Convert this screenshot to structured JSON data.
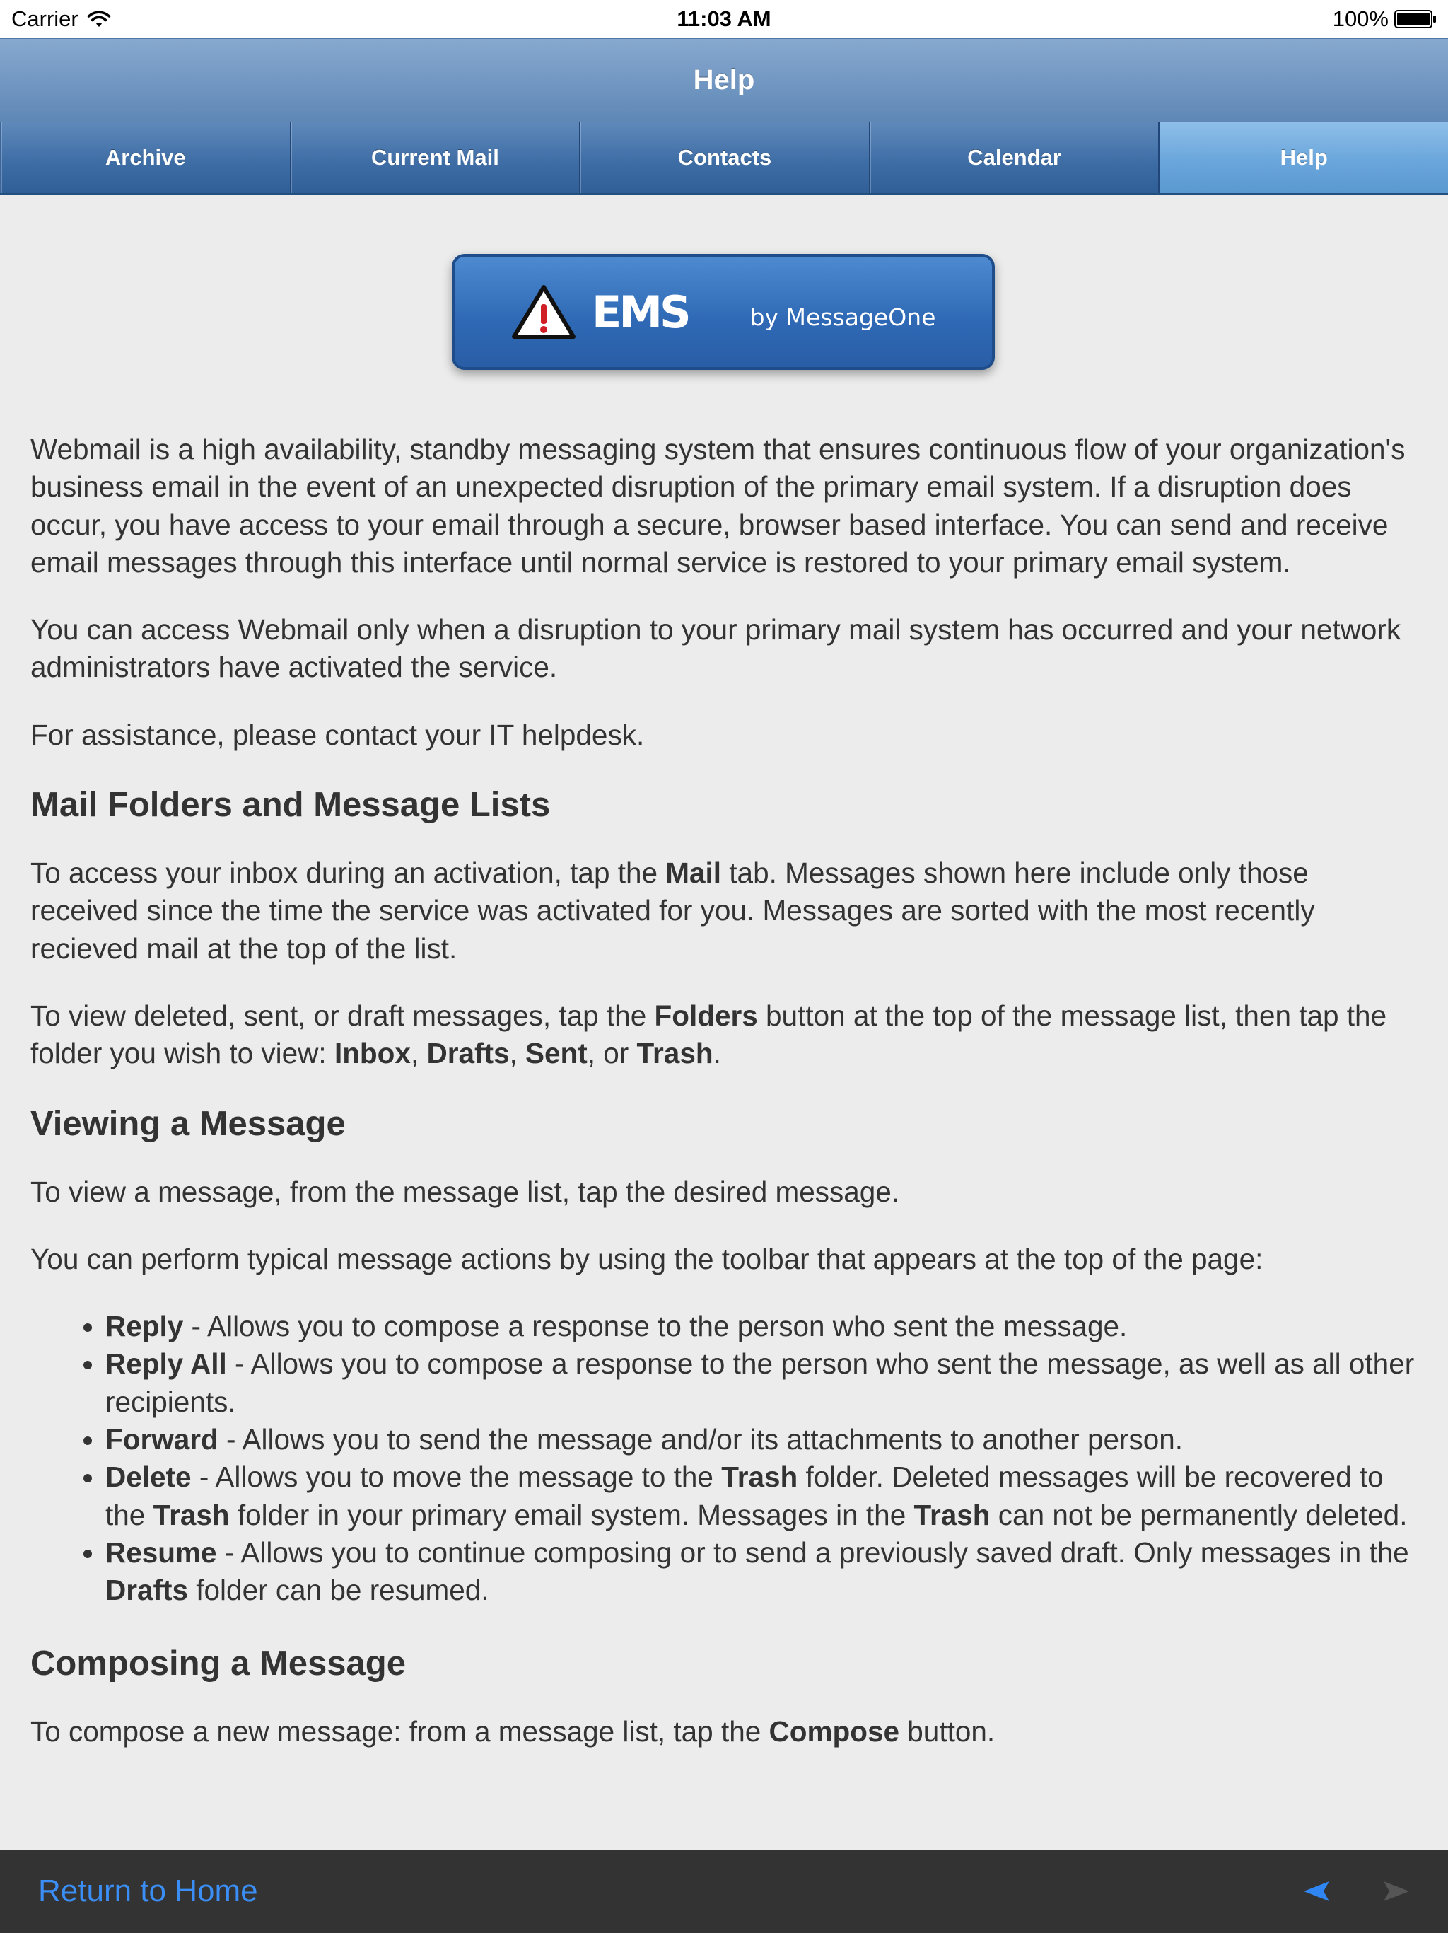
{
  "status_bar": {
    "carrier": "Carrier",
    "time": "11:03 AM",
    "battery": "100%"
  },
  "title_bar": {
    "title": "Help"
  },
  "tabs": [
    {
      "label": "Archive",
      "active": false
    },
    {
      "label": "Current Mail",
      "active": false
    },
    {
      "label": "Contacts",
      "active": false
    },
    {
      "label": "Calendar",
      "active": false
    },
    {
      "label": "Help",
      "active": true
    }
  ],
  "logo": {
    "mark": "EMS",
    "byline": "by MessageOne"
  },
  "content": {
    "intro": [
      "Webmail is a high availability, standby messaging system that ensures continuous flow of your organization's business email in the event of an unexpected disruption of the primary email system. If a disruption does occur, you have access to your email through a secure, browser based interface. You can send and receive email messages through this interface until normal service is restored to your primary email system.",
      "You can access Webmail only when a disruption to your primary mail system has occurred and your network administrators have activated the service.",
      "For assistance, please contact your IT helpdesk."
    ],
    "section_folders": {
      "heading": "Mail Folders and Message Lists",
      "p1_a": "To access your inbox during an activation, tap the ",
      "p1_b": "Mail",
      "p1_c": " tab. Messages shown here include only those received since the time the service was activated for you. Messages are sorted with the most recently recieved mail at the top of the list.",
      "p2_a": "To view deleted, sent, or draft messages, tap the ",
      "p2_b": "Folders",
      "p2_c": " button at the top of the message list, then tap the folder you wish to view: ",
      "p2_inbox": "Inbox",
      "p2_sep1": ", ",
      "p2_drafts": "Drafts",
      "p2_sep2": ", ",
      "p2_sent": "Sent",
      "p2_sep3": ", or ",
      "p2_trash": "Trash",
      "p2_end": "."
    },
    "section_viewing": {
      "heading": "Viewing a Message",
      "p1": "To view a message, from the message list, tap the desired message.",
      "p2": "You can perform typical message actions by using the toolbar that appears at the top of the page:",
      "items": {
        "reply_name": "Reply",
        "reply_desc": " - Allows you to compose a response to the person who sent the message.",
        "replyall_name": "Reply All",
        "replyall_desc": " - Allows you to compose a response to the person who sent the message, as well as all other recipients.",
        "forward_name": "Forward",
        "forward_desc": " - Allows you to send the message and/or its attachments to another person.",
        "delete_name": "Delete",
        "delete_a": " - Allows you to move the message to the ",
        "delete_trash1": "Trash",
        "delete_b": " folder. Deleted messages will be recovered to the ",
        "delete_trash2": "Trash",
        "delete_c": " folder in your primary email system. Messages in the ",
        "delete_trash3": "Trash",
        "delete_d": " can not be permanently deleted.",
        "resume_name": "Resume",
        "resume_a": " - Allows you to continue composing or to send a previously saved draft. Only messages in the ",
        "resume_drafts": "Drafts",
        "resume_b": " folder can be resumed."
      }
    },
    "section_composing": {
      "heading": "Composing a Message",
      "p1_a": "To compose a new message: from a message list, tap the ",
      "p1_b": "Compose",
      "p1_c": " button."
    }
  },
  "bottom_bar": {
    "home_link": "Return to Home"
  },
  "colors": {
    "link": "#3a8ef5",
    "bottom_bar": "#333333",
    "tab_active": "#6aa6db",
    "tab_inactive": "#3f6ea6"
  }
}
